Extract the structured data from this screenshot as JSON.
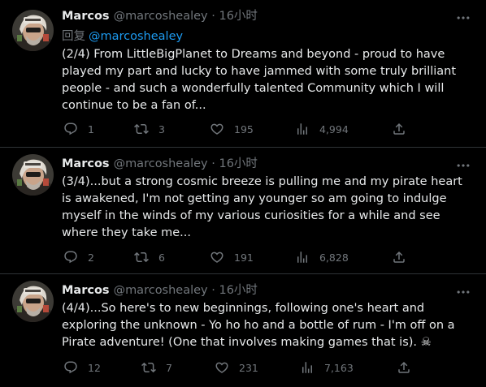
{
  "tweets": [
    {
      "name": "Marcos",
      "handle": "@marcoshealey",
      "dot": "·",
      "time": "16小时",
      "reply_label": "回复",
      "reply_handle": "@marcoshealey",
      "text": "(2/4) From LittleBigPlanet to Dreams and beyond - proud to have played my part and lucky to have jammed with some truly brilliant people - and such a wonderfully talented Community which I will continue to be a fan of...",
      "replies": "1",
      "retweets": "3",
      "likes": "195",
      "views": "4,994"
    },
    {
      "name": "Marcos",
      "handle": "@marcoshealey",
      "dot": "·",
      "time": "16小时",
      "text": "(3/4)...but a strong cosmic breeze is pulling me and my pirate heart is awakened, I'm not getting any younger so am going to indulge myself in the winds of my various curiosities for a while and see where they take me...",
      "replies": "2",
      "retweets": "6",
      "likes": "191",
      "views": "6,828"
    },
    {
      "name": "Marcos",
      "handle": "@marcoshealey",
      "dot": "·",
      "time": "16小时",
      "text": "(4/4)...So here's to new beginnings, following one's heart and exploring the unknown - Yo ho ho and a bottle of rum - I'm off on a Pirate adventure! (One that involves making games that is). ☠",
      "replies": "12",
      "retweets": "7",
      "likes": "231",
      "views": "7,163"
    }
  ],
  "colors": {
    "background": "#000000",
    "text": "#e7e9ea",
    "muted": "#71767b",
    "link": "#1d9bf0",
    "divider": "#2f3336"
  },
  "icons": [
    "more-icon",
    "reply-icon",
    "retweet-icon",
    "like-icon",
    "views-icon",
    "share-icon"
  ]
}
